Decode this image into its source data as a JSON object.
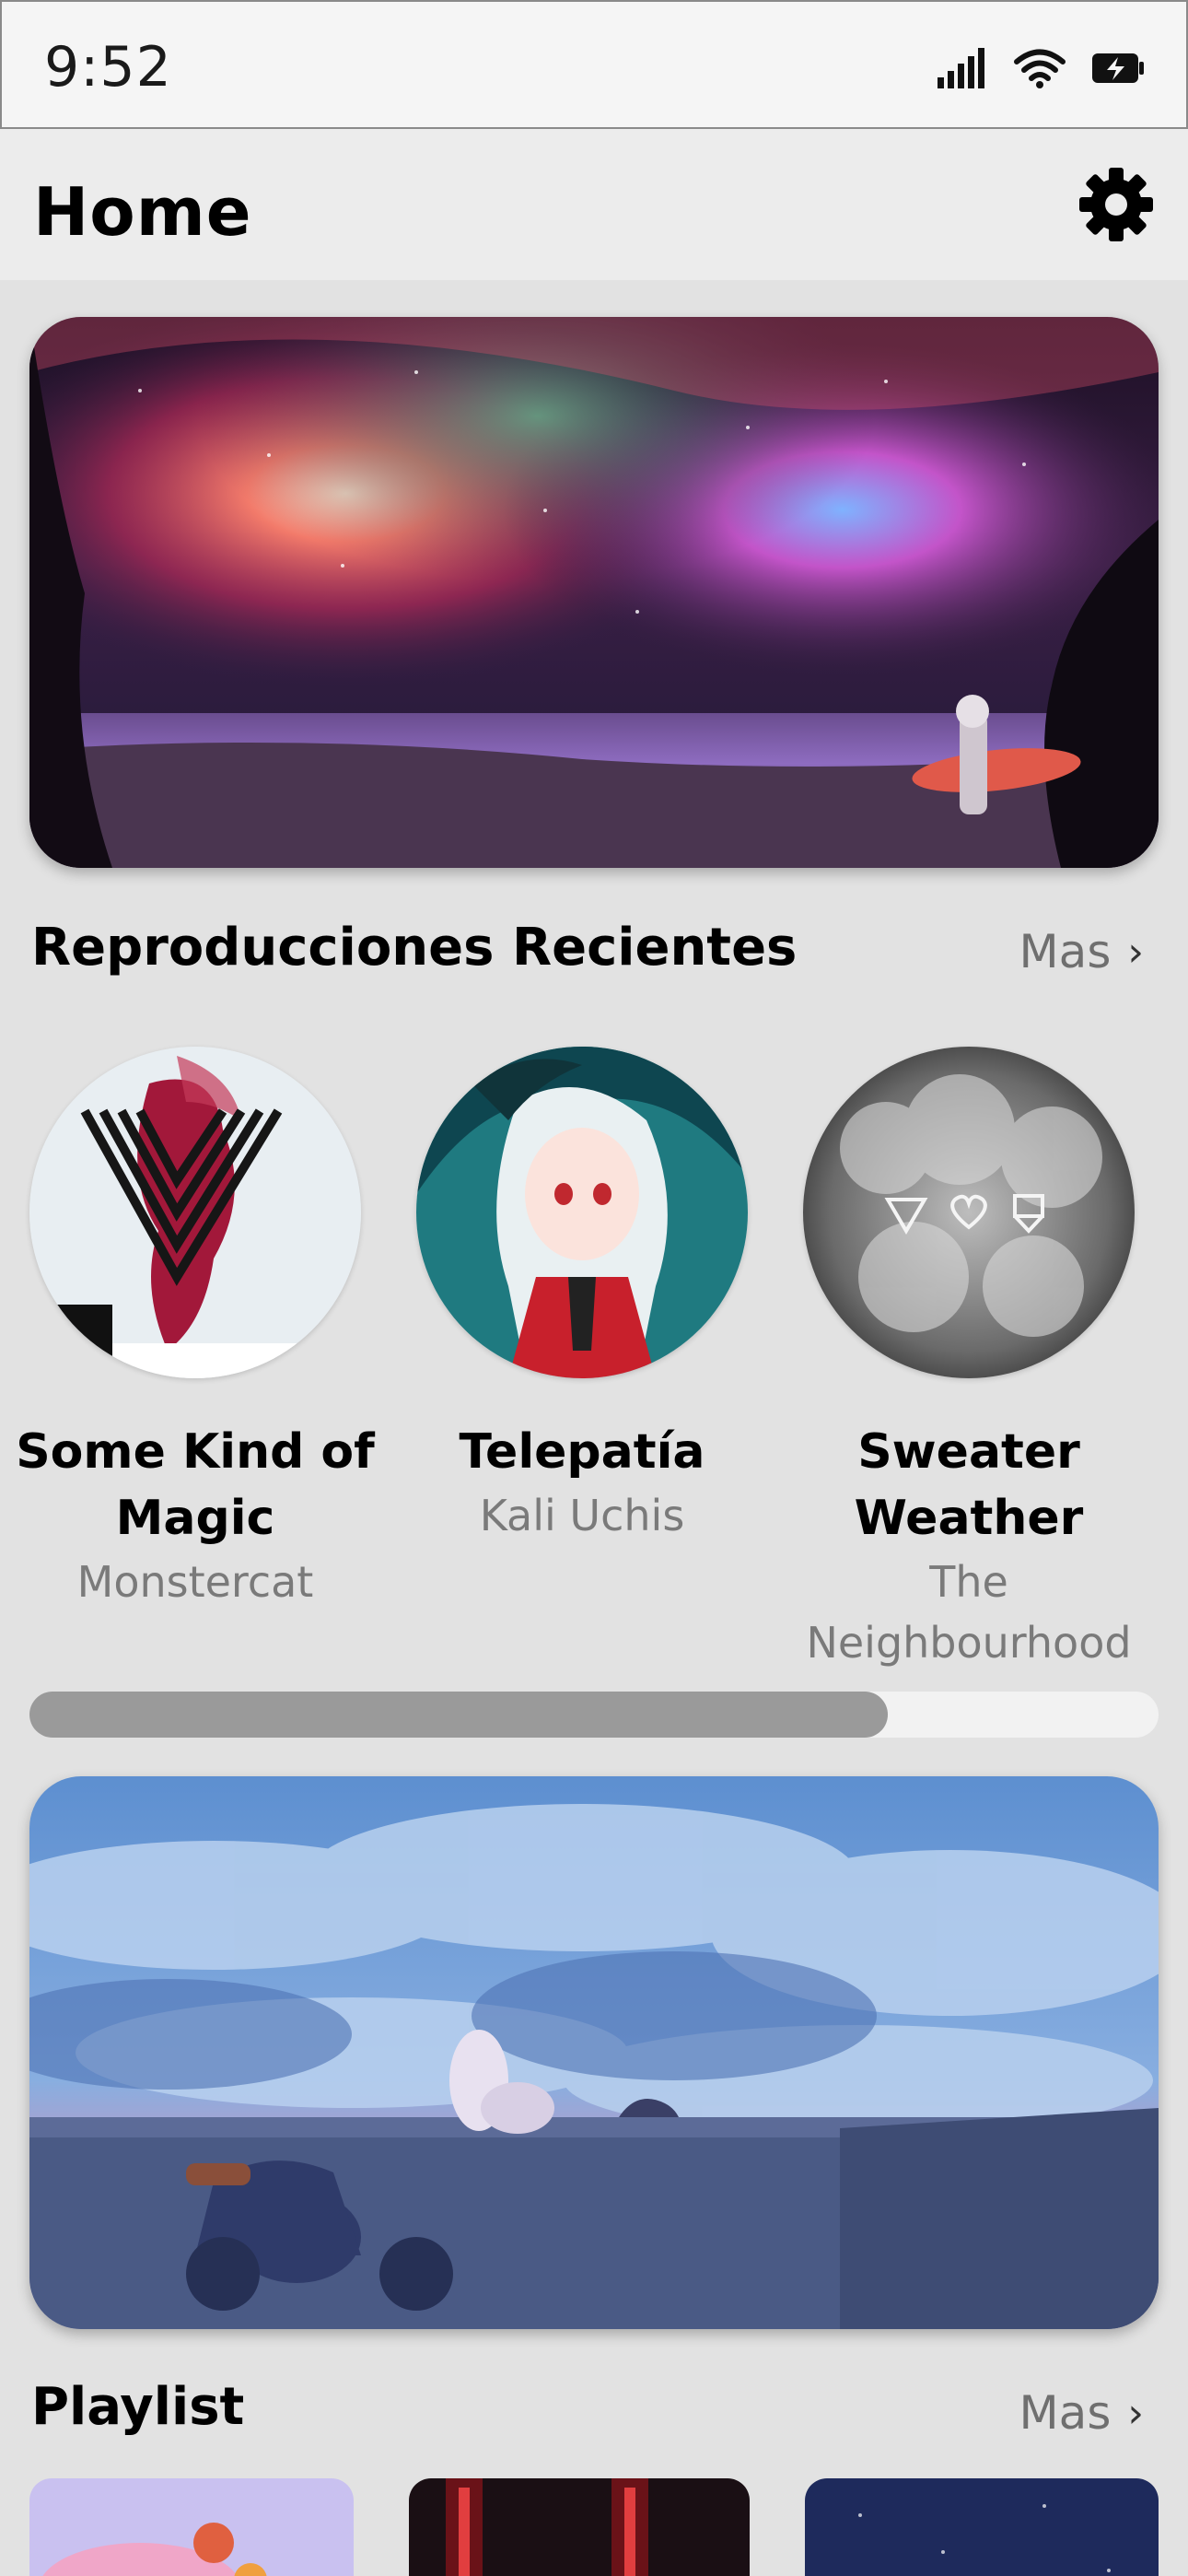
{
  "status": {
    "time": "9:52"
  },
  "header": {
    "title": "Home"
  },
  "recent": {
    "title": "Reproducciones Recientes",
    "more": "Mas",
    "items": [
      {
        "title": "Some Kind of Magic",
        "artist": "Monstercat"
      },
      {
        "title": "Telepatía",
        "artist": "Kali Uchis"
      },
      {
        "title": "Sweater Weather",
        "artist": "The Neighbourhood"
      }
    ],
    "scroll_progress": 0.76
  },
  "playlist": {
    "title": "Playlist",
    "more": "Mas"
  },
  "colors": {
    "background": "#e2e2e2",
    "muted_text": "#7a7a7a",
    "scroll_thumb": "#9a9a9a"
  },
  "icons": [
    "signal-icon",
    "wifi-icon",
    "battery-charging-icon",
    "gear-icon",
    "chevron-right-icon"
  ]
}
